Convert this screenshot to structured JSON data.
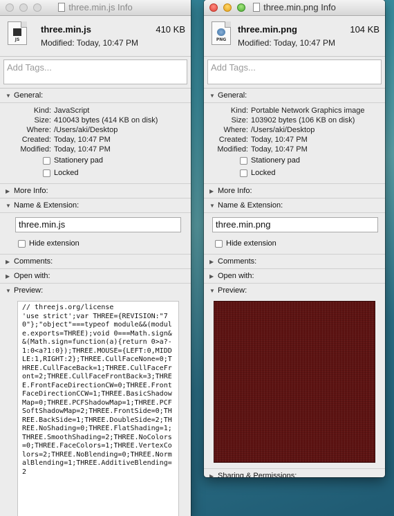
{
  "left": {
    "title": "three.min.js Info",
    "file_name": "three.min.js",
    "size_short": "410 KB",
    "modified": "Modified: Today, 10:47 PM",
    "icon_tag": "JS",
    "tags_placeholder": "Add Tags...",
    "general_label": "General:",
    "general": {
      "kind_label": "Kind:",
      "kind": "JavaScript",
      "size_label": "Size:",
      "size": "410043 bytes (414 KB on disk)",
      "where_label": "Where:",
      "where": "/Users/aki/Desktop",
      "created_label": "Created:",
      "created": "Today, 10:47 PM",
      "modified_label": "Modified:",
      "modified": "Today, 10:47 PM"
    },
    "stationery_label": "Stationery pad",
    "locked_label": "Locked",
    "more_info_label": "More Info:",
    "name_ext_label": "Name & Extension:",
    "name_value": "three.min.js",
    "hide_ext_label": "Hide extension",
    "comments_label": "Comments:",
    "open_with_label": "Open with:",
    "preview_label": "Preview:",
    "preview_text": "// threejs.org/license\n'use strict';var THREE={REVISION:\"70\"};\"object\"===typeof module&&(module.exports=THREE);void 0===Math.sign&&(Math.sign=function(a){return 0>a?-1:0<a?1:0});THREE.MOUSE={LEFT:0,MIDDLE:1,RIGHT:2};THREE.CullFaceNone=0;THREE.CullFaceBack=1;THREE.CullFaceFront=2;THREE.CullFaceFrontBack=3;THREE.FrontFaceDirectionCW=0;THREE.FrontFaceDirectionCCW=1;THREE.BasicShadowMap=0;THREE.PCFShadowMap=1;THREE.PCFSoftShadowMap=2;THREE.FrontSide=0;THREE.BackSide=1;THREE.DoubleSide=2;THREE.NoShading=0;THREE.FlatShading=1;THREE.SmoothShading=2;THREE.NoColors=0;THREE.FaceColors=1;THREE.VertexColors=2;THREE.NoBlending=0;THREE.NormalBlending=1;THREE.AdditiveBlending=2"
  },
  "right": {
    "title": "three.min.png Info",
    "file_name": "three.min.png",
    "size_short": "104 KB",
    "modified": "Modified: Today, 10:47 PM",
    "icon_tag": "PNG",
    "tags_placeholder": "Add Tags...",
    "general_label": "General:",
    "general": {
      "kind_label": "Kind:",
      "kind": "Portable Network Graphics image",
      "size_label": "Size:",
      "size": "103902 bytes (106 KB on disk)",
      "where_label": "Where:",
      "where": "/Users/aki/Desktop",
      "created_label": "Created:",
      "created": "Today, 10:47 PM",
      "modified_label": "Modified:",
      "modified": "Today, 10:47 PM"
    },
    "stationery_label": "Stationery pad",
    "locked_label": "Locked",
    "more_info_label": "More Info:",
    "name_ext_label": "Name & Extension:",
    "name_value": "three.min.png",
    "hide_ext_label": "Hide extension",
    "comments_label": "Comments:",
    "open_with_label": "Open with:",
    "preview_label": "Preview:",
    "sharing_label": "Sharing & Permissions:",
    "preview_color": "#5e1312"
  },
  "colors": {
    "desktop": "#2d7c93",
    "close": "#e0443e",
    "minimize": "#e5a21d",
    "zoom": "#4fb036"
  }
}
